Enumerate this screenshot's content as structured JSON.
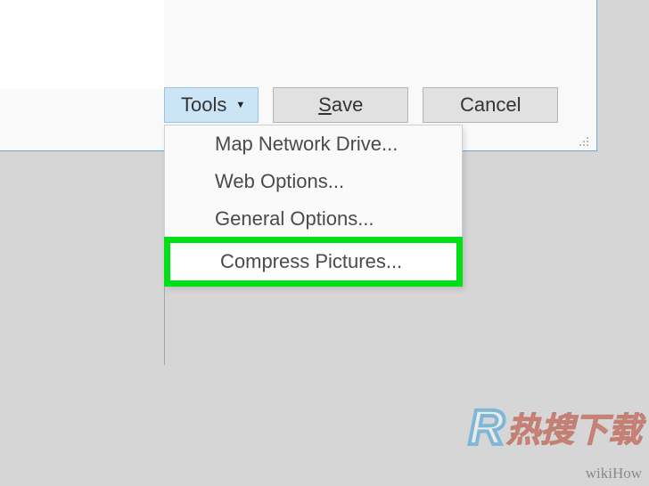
{
  "dialog": {
    "tools_label": "Tools",
    "save_label_u": "S",
    "save_label_rest": "ave",
    "cancel_label": "Cancel"
  },
  "menu": {
    "items": [
      "Map Network Drive...",
      "Web Options...",
      "General Options...",
      "Compress Pictures..."
    ]
  },
  "watermark": {
    "logo_r": "R",
    "logo_text": "热搜下载",
    "credit": "wikiHow"
  }
}
